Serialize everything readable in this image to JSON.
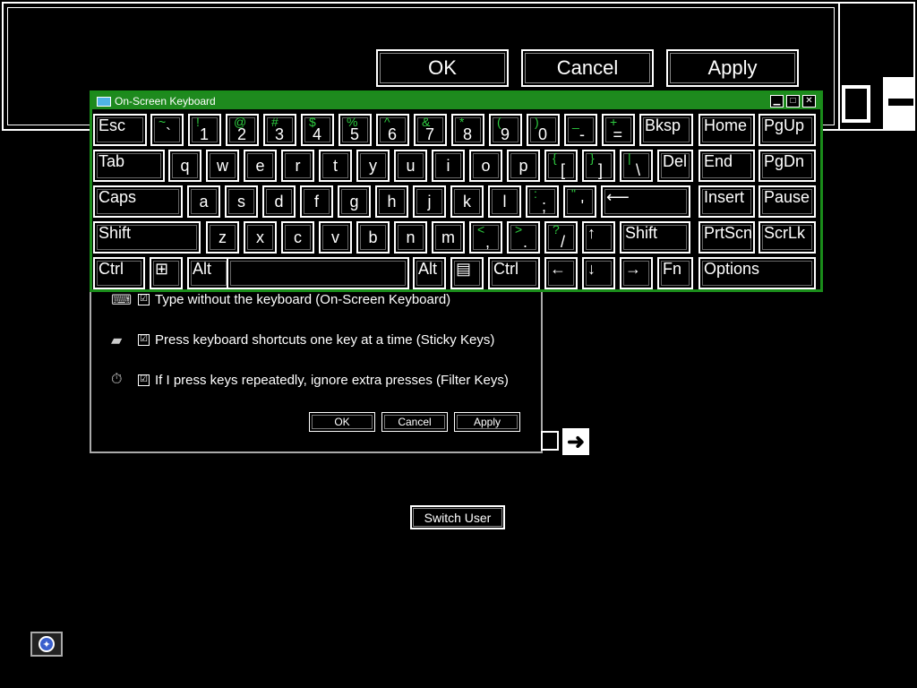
{
  "magnifier": {
    "ok_label": "OK",
    "cancel_label": "Cancel",
    "apply_label": "Apply"
  },
  "dialog": {
    "options": [
      {
        "label": "Type without the keyboard (On-Screen Keyboard)",
        "checked": "☑",
        "icon": "keyboard-icon"
      },
      {
        "label": "Press keyboard shortcuts one key at a time (Sticky Keys)",
        "checked": "☑",
        "icon": "sticky-keys-icon"
      },
      {
        "label": "If I press keys repeatedly, ignore extra presses (Filter Keys)",
        "checked": "☑",
        "icon": "stopwatch-icon"
      }
    ],
    "ok_label": "OK",
    "cancel_label": "Cancel",
    "apply_label": "Apply"
  },
  "switch_user_label": "Switch User",
  "osk": {
    "title": "On-Screen Keyboard",
    "accent": "#1e8a1e",
    "shift_color": "#2ecc40",
    "window_buttons": {
      "minimize": "▁",
      "maximize": "□",
      "close": "✕"
    },
    "rows": [
      [
        {
          "label": "Esc"
        },
        {
          "shift": "~",
          "main": "`"
        },
        {
          "shift": "!",
          "main": "1"
        },
        {
          "shift": "@",
          "main": "2"
        },
        {
          "shift": "#",
          "main": "3"
        },
        {
          "shift": "$",
          "main": "4"
        },
        {
          "shift": "%",
          "main": "5"
        },
        {
          "shift": "^",
          "main": "6"
        },
        {
          "shift": "&",
          "main": "7"
        },
        {
          "shift": "*",
          "main": "8"
        },
        {
          "shift": "(",
          "main": "9"
        },
        {
          "shift": ")",
          "main": "0"
        },
        {
          "shift": "_",
          "main": "-"
        },
        {
          "shift": "+",
          "main": "="
        },
        {
          "label": "Bksp"
        },
        {
          "label": "Home"
        },
        {
          "label": "PgUp"
        }
      ],
      [
        {
          "label": "Tab"
        },
        {
          "label": "q"
        },
        {
          "label": "w"
        },
        {
          "label": "e"
        },
        {
          "label": "r"
        },
        {
          "label": "t"
        },
        {
          "label": "y"
        },
        {
          "label": "u"
        },
        {
          "label": "i"
        },
        {
          "label": "o"
        },
        {
          "label": "p"
        },
        {
          "shift": "{",
          "main": "["
        },
        {
          "shift": "}",
          "main": "]"
        },
        {
          "shift": "|",
          "main": "\\"
        },
        {
          "label": "Del"
        },
        {
          "label": "End"
        },
        {
          "label": "PgDn"
        }
      ],
      [
        {
          "label": "Caps"
        },
        {
          "label": "a"
        },
        {
          "label": "s"
        },
        {
          "label": "d"
        },
        {
          "label": "f"
        },
        {
          "label": "g"
        },
        {
          "label": "h"
        },
        {
          "label": "j"
        },
        {
          "label": "k"
        },
        {
          "label": "l"
        },
        {
          "shift": ":",
          "main": ";"
        },
        {
          "shift": "\"",
          "main": "'"
        },
        {
          "label": "⟵"
        },
        {
          "label": "Insert"
        },
        {
          "label": "Pause"
        }
      ],
      [
        {
          "label": "Shift"
        },
        {
          "label": "z"
        },
        {
          "label": "x"
        },
        {
          "label": "c"
        },
        {
          "label": "v"
        },
        {
          "label": "b"
        },
        {
          "label": "n"
        },
        {
          "label": "m"
        },
        {
          "shift": "<",
          "main": ","
        },
        {
          "shift": ">",
          "main": "."
        },
        {
          "shift": "?",
          "main": "/"
        },
        {
          "label": "↑"
        },
        {
          "label": "Shift"
        },
        {
          "label": "PrtScn"
        },
        {
          "label": "ScrLk"
        }
      ],
      [
        {
          "label": "Ctrl"
        },
        {
          "label": "⊞"
        },
        {
          "label": "Alt"
        },
        {
          "label": ""
        },
        {
          "label": "Alt"
        },
        {
          "label": "▤"
        },
        {
          "label": "Ctrl"
        },
        {
          "label": "←"
        },
        {
          "label": "↓"
        },
        {
          "label": "→"
        },
        {
          "label": "Fn"
        },
        {
          "label": "Options"
        }
      ]
    ]
  }
}
